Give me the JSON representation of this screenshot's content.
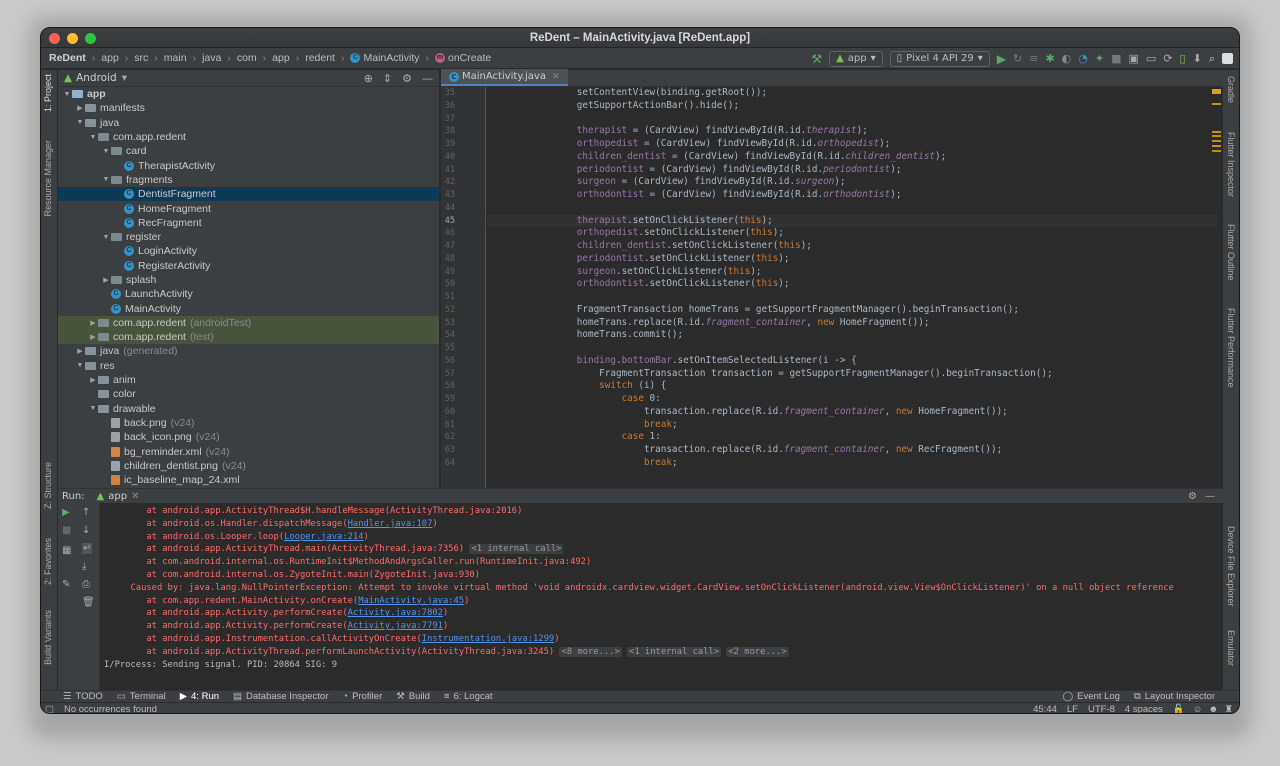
{
  "window": {
    "title": "ReDent – MainActivity.java [ReDent.app]"
  },
  "breadcrumb": [
    "ReDent",
    "app",
    "src",
    "main",
    "java",
    "com",
    "app",
    "redent",
    "MainActivity",
    "onCreate"
  ],
  "toolbar": {
    "config": "app",
    "device": "Pixel 4 API 29"
  },
  "left_tools": [
    "1: Project",
    "Resource Manager",
    "Z: Structure",
    "2: Favorites",
    "Build Variants"
  ],
  "right_tools": [
    "Gradle",
    "Flutter Inspector",
    "Flutter Outline",
    "Flutter Performance",
    "Device File Explorer",
    "Emulator"
  ],
  "project": {
    "view": "Android",
    "tree": [
      {
        "label": "app",
        "type": "app",
        "depth": 0,
        "arrow": "down",
        "bold": true
      },
      {
        "label": "manifests",
        "type": "folder",
        "depth": 1,
        "arrow": "right"
      },
      {
        "label": "java",
        "type": "folder",
        "depth": 1,
        "arrow": "down"
      },
      {
        "label": "com.app.redent",
        "type": "pkg",
        "depth": 2,
        "arrow": "down"
      },
      {
        "label": "card",
        "type": "pkg",
        "depth": 3,
        "arrow": "down"
      },
      {
        "label": "TherapistActivity",
        "type": "class",
        "depth": 4
      },
      {
        "label": "fragments",
        "type": "pkg",
        "depth": 3,
        "arrow": "down"
      },
      {
        "label": "DentistFragment",
        "type": "class",
        "depth": 4,
        "selected": true
      },
      {
        "label": "HomeFragment",
        "type": "class",
        "depth": 4
      },
      {
        "label": "RecFragment",
        "type": "class",
        "depth": 4
      },
      {
        "label": "register",
        "type": "pkg",
        "depth": 3,
        "arrow": "down"
      },
      {
        "label": "LoginActivity",
        "type": "class",
        "depth": 4
      },
      {
        "label": "RegisterActivity",
        "type": "class",
        "depth": 4
      },
      {
        "label": "splash",
        "type": "pkg",
        "depth": 3,
        "arrow": "right"
      },
      {
        "label": "LaunchActivity",
        "type": "class",
        "depth": 3
      },
      {
        "label": "MainActivity",
        "type": "class",
        "depth": 3
      },
      {
        "label": "com.app.redent",
        "suffix": "(androidTest)",
        "type": "pkg",
        "depth": 2,
        "arrow": "right",
        "test": true
      },
      {
        "label": "com.app.redent",
        "suffix": "(test)",
        "type": "pkg",
        "depth": 2,
        "arrow": "right",
        "test": true
      },
      {
        "label": "java",
        "suffix": "(generated)",
        "type": "folder",
        "depth": 1,
        "arrow": "right"
      },
      {
        "label": "res",
        "type": "folder",
        "depth": 1,
        "arrow": "down"
      },
      {
        "label": "anim",
        "type": "folder",
        "depth": 2,
        "arrow": "right"
      },
      {
        "label": "color",
        "type": "folder",
        "depth": 2
      },
      {
        "label": "drawable",
        "type": "folder",
        "depth": 2,
        "arrow": "down"
      },
      {
        "label": "back.png",
        "suffix": "(v24)",
        "type": "file",
        "depth": 3
      },
      {
        "label": "back_icon.png",
        "suffix": "(v24)",
        "type": "file",
        "depth": 3
      },
      {
        "label": "bg_reminder.xml",
        "suffix": "(v24)",
        "type": "xml",
        "depth": 3
      },
      {
        "label": "children_dentist.png",
        "suffix": "(v24)",
        "type": "file",
        "depth": 3
      },
      {
        "label": "ic_baseline_map_24.xml",
        "type": "xml",
        "depth": 3
      }
    ]
  },
  "editor": {
    "tab": "MainActivity.java",
    "current_line": 45,
    "lines": [
      {
        "n": 35,
        "h": "        setContentView(binding.getRoot());"
      },
      {
        "n": 36,
        "h": "        getSupportActionBar().hide();"
      },
      {
        "n": 37,
        "h": ""
      },
      {
        "n": 38,
        "h": "        <span class=\"fd\">therapist</span> = (CardView) findViewById(R.id.<span class=\"it\">therapist</span>);"
      },
      {
        "n": 39,
        "h": "        <span class=\"fd\">orthopedist</span> = (CardView) findViewById(R.id.<span class=\"it\">orthopedist</span>);"
      },
      {
        "n": 40,
        "h": "        <span class=\"fd\">children_dentist</span> = (CardView) findViewById(R.id.<span class=\"it\">children_dentist</span>);"
      },
      {
        "n": 41,
        "h": "        <span class=\"fd\">periodontist</span> = (CardView) findViewById(R.id.<span class=\"it\">periodontist</span>);"
      },
      {
        "n": 42,
        "h": "        <span class=\"fd\">surgeon</span> = (CardView) findViewById(R.id.<span class=\"it\">surgeon</span>);"
      },
      {
        "n": 43,
        "h": "        <span class=\"fd\">orthodontist</span> = (CardView) findViewById(R.id.<span class=\"it\">orthodontist</span>);"
      },
      {
        "n": 44,
        "h": ""
      },
      {
        "n": 45,
        "h": "        <span class=\"fd\">therapist</span>.setOnClickListener(<span class=\"kw\">this</span>);"
      },
      {
        "n": 46,
        "h": "        <span class=\"fd\">orthopedist</span>.setOnClickListener(<span class=\"kw\">this</span>);"
      },
      {
        "n": 47,
        "h": "        <span class=\"fd\">children_dentist</span>.setOnClickListener(<span class=\"kw\">this</span>);"
      },
      {
        "n": 48,
        "h": "        <span class=\"fd\">periodontist</span>.setOnClickListener(<span class=\"kw\">this</span>);"
      },
      {
        "n": 49,
        "h": "        <span class=\"fd\">surgeon</span>.setOnClickListener(<span class=\"kw\">this</span>);"
      },
      {
        "n": 50,
        "h": "        <span class=\"fd\">orthodontist</span>.setOnClickListener(<span class=\"kw\">this</span>);"
      },
      {
        "n": 51,
        "h": ""
      },
      {
        "n": 52,
        "h": "        FragmentTransaction homeTrans = getSupportFragmentManager().beginTransaction();"
      },
      {
        "n": 53,
        "h": "        homeTrans.replace(R.id.<span class=\"it\">fragment_container</span>, <span class=\"kw\">new</span> HomeFragment());"
      },
      {
        "n": 54,
        "h": "        homeTrans.commit();"
      },
      {
        "n": 55,
        "h": ""
      },
      {
        "n": 56,
        "h": "        <span class=\"fd\">binding</span>.<span class=\"fd\">bottomBar</span>.setOnItemSelectedListener(i -&gt; {"
      },
      {
        "n": 57,
        "h": "            FragmentTransaction transaction = getSupportFragmentManager().beginTransaction();"
      },
      {
        "n": 58,
        "h": "            <span class=\"kw\">switch</span> (i) {"
      },
      {
        "n": 59,
        "h": "                <span class=\"kw\">case</span> 0:"
      },
      {
        "n": 60,
        "h": "                    transaction.replace(R.id.<span class=\"it\">fragment_container</span>, <span class=\"kw\">new</span> HomeFragment());"
      },
      {
        "n": 61,
        "h": "                    <span class=\"kw\">break</span>;"
      },
      {
        "n": 62,
        "h": "                <span class=\"kw\">case</span> 1:"
      },
      {
        "n": 63,
        "h": "                    transaction.replace(R.id.<span class=\"it\">fragment_container</span>, <span class=\"kw\">new</span> RecFragment());"
      },
      {
        "n": 64,
        "h": "                    <span class=\"kw\">break</span>;"
      }
    ]
  },
  "run": {
    "label": "Run:",
    "tab": "app",
    "lines": [
      {
        "h": "        at android.app.ActivityThread$H.handleMessage(ActivityThread.java:2016)"
      },
      {
        "h": "        at android.os.Handler.dispatchMessage(<span class=\"lnk\">Handler.java:107</span>)"
      },
      {
        "h": "        at android.os.Looper.loop(<span class=\"lnk\">Looper.java:214</span>)"
      },
      {
        "h": "        at android.app.ActivityThread.main(ActivityThread.java:7356) <span class=\"pill\">&lt;1 internal call&gt;</span>"
      },
      {
        "h": "        at com.android.internal.os.RuntimeInit$MethodAndArgsCaller.run(RuntimeInit.java:492)"
      },
      {
        "h": "        at com.android.internal.os.ZygoteInit.main(ZygoteInit.java:930)"
      },
      {
        "h": "     Caused by: java.lang.NullPointerException: Attempt to invoke virtual method 'void androidx.cardview.widget.CardView.setOnClickListener(android.view.View$OnClickListener)' on a null object reference"
      },
      {
        "h": "        at com.app.redent.MainActivity.onCreate(<span class=\"lnk\">MainActivity.java:45</span>)"
      },
      {
        "h": "        at android.app.Activity.performCreate(<span class=\"lnk\">Activity.java:7802</span>)"
      },
      {
        "h": "        at android.app.Activity.performCreate(<span class=\"lnk\">Activity.java:7791</span>)"
      },
      {
        "h": "        at android.app.Instrumentation.callActivityOnCreate(<span class=\"lnk\">Instrumentation.java:1299</span>)"
      },
      {
        "h": "        at android.app.ActivityThread.performLaunchActivity(ActivityThread.java:3245) <span class=\"pill\">&lt;8 more...&gt;</span> <span class=\"pill\">&lt;1 internal call&gt;</span> <span class=\"pill\">&lt;2 more...&gt;</span>"
      },
      {
        "h": "I/Process: Sending signal. PID: 20864 SIG: 9",
        "info": true
      }
    ]
  },
  "bottom_tools": [
    "TODO",
    "Terminal",
    "4: Run",
    "Database Inspector",
    "Profiler",
    "Build",
    "6: Logcat"
  ],
  "bottom_right_tools": [
    "Event Log",
    "Layout Inspector"
  ],
  "status": {
    "message": "No occurrences found",
    "position": "45:44",
    "line_sep": "LF",
    "encoding": "UTF-8",
    "indent": "4 spaces"
  },
  "colors": {
    "selection": "#0d3a58",
    "test_bg": "#49543c",
    "error": "#ff6b68",
    "link": "#5394ec",
    "accent": "#4a88c7"
  }
}
